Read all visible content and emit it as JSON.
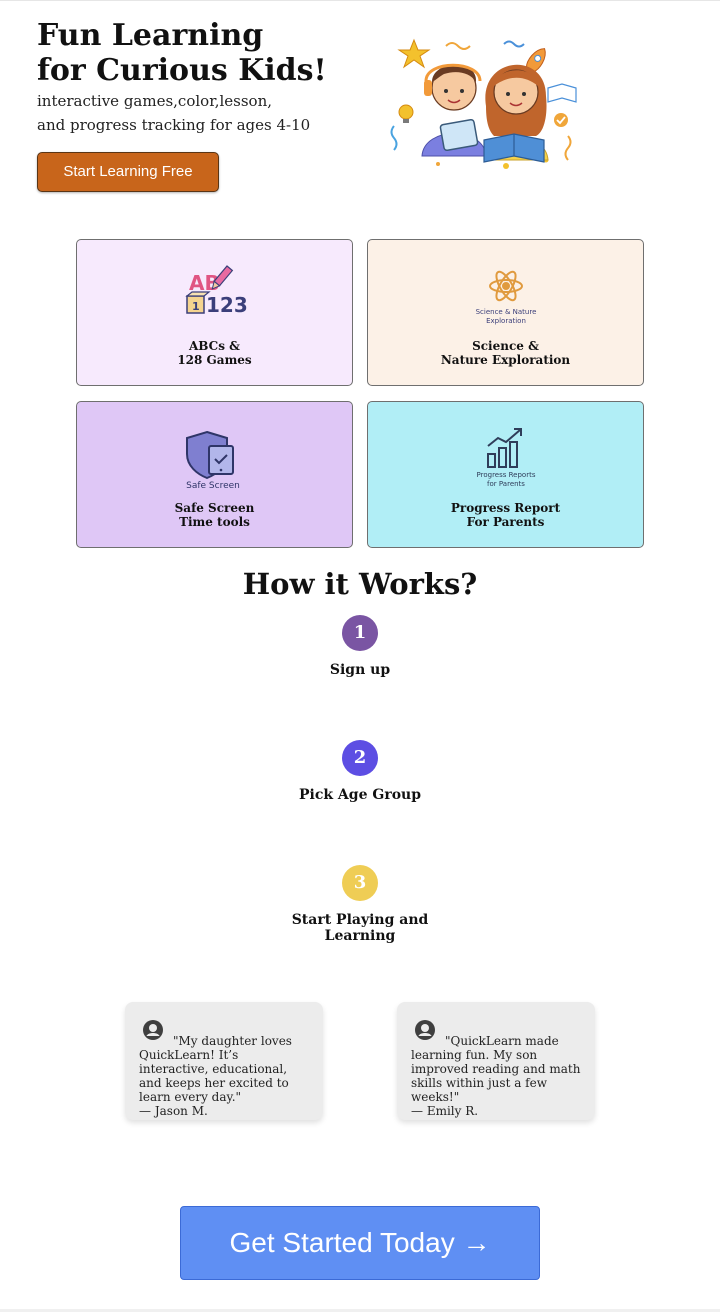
{
  "hero": {
    "title_line1": "Fun Learning",
    "title_line2": "for Curious Kids!",
    "subtitle_line1": "interactive games,color,lesson,",
    "subtitle_line2": "and progress tracking for ages 4-10",
    "cta_label": "Start Learning Free",
    "illustration": "kids-learning-illustration"
  },
  "features": [
    {
      "icon": "abc-123-blocks-icon",
      "icon_text_top": "AB",
      "icon_text_bottom": "123",
      "icon_block_text": "1",
      "line1": "ABCs &",
      "line2": "128 Games",
      "bg": "#f7eafd"
    },
    {
      "icon": "atom-icon",
      "icon_caption_line1": "Science & Nature",
      "icon_caption_line2": "Exploration",
      "line1": "Science &",
      "line2": "Nature Exploration",
      "bg": "#fcf1e7"
    },
    {
      "icon": "shield-tablet-icon",
      "icon_caption": "Safe Screen",
      "line1": "Safe Screen",
      "line2": "Time tools",
      "bg": "#dfc7f6"
    },
    {
      "icon": "bar-chart-growth-icon",
      "icon_caption_line1": "Progress Reports",
      "icon_caption_line2": "for Parents",
      "line1": "Progress Report",
      "line2": "For Parents",
      "bg": "#b1eef6"
    }
  ],
  "how": {
    "title": "How it Works?",
    "steps": [
      {
        "number": "1",
        "line1": "Sign up",
        "line2": "",
        "color": "#7a55a3"
      },
      {
        "number": "2",
        "line1": "Pick Age Group",
        "line2": "",
        "color": "#5d4ee3"
      },
      {
        "number": "3",
        "line1": "Start Playing and",
        "line2": "Learning",
        "color": "#efcd55"
      }
    ]
  },
  "testimonials": [
    {
      "text": "\"My daughter loves QuickLearn! It’s interactive, educational, and keeps her excited to learn every day.\"",
      "author": "— Jason M."
    },
    {
      "text": "\"QuickLearn made learning fun. My son improved reading and math skills within just a few weeks!\"",
      "author": "— Emily R."
    }
  ],
  "cta": {
    "label": "Get Started Today →"
  },
  "colors": {
    "accent_orange": "#c8651b",
    "accent_blue": "#5f8ff3"
  }
}
